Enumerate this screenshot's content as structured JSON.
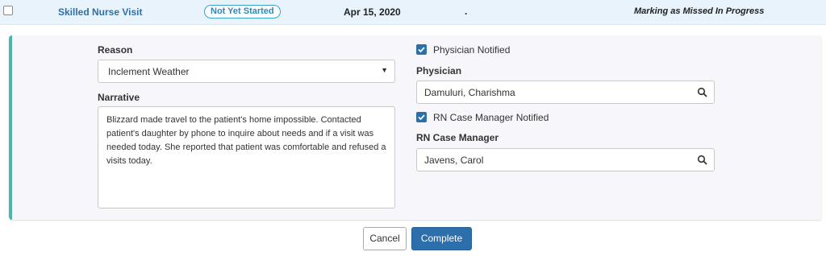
{
  "row": {
    "title": "Skilled Nurse Visit",
    "status": "Not Yet Started",
    "date": "Apr 15, 2020",
    "dot": ".",
    "progress": "Marking as Missed In Progress"
  },
  "form": {
    "reason_label": "Reason",
    "reason_value": "Inclement Weather",
    "narrative_label": "Narrative",
    "narrative_value": "Blizzard made travel to the patient's home impossible. Contacted patient's daughter by phone to inquire about needs and if a visit was needed today. She reported that patient was comfortable and refused a visits today.",
    "physician_notified_label": "Physician Notified",
    "physician_notified_checked": true,
    "physician_label": "Physician",
    "physician_value": "Damuluri, Charishma",
    "rn_notified_label": "RN Case Manager Notified",
    "rn_notified_checked": true,
    "rn_label": "RN Case Manager",
    "rn_value": "Javens, Carol"
  },
  "actions": {
    "cancel_label": "Cancel",
    "complete_label": "Complete"
  },
  "colors": {
    "accent": "#2d6fab",
    "panel_border": "#4ab5a8",
    "status": "#2f88b5"
  },
  "icons": [
    "checkbox-icon",
    "chevron-down-icon",
    "search-icon",
    "check-icon"
  ]
}
